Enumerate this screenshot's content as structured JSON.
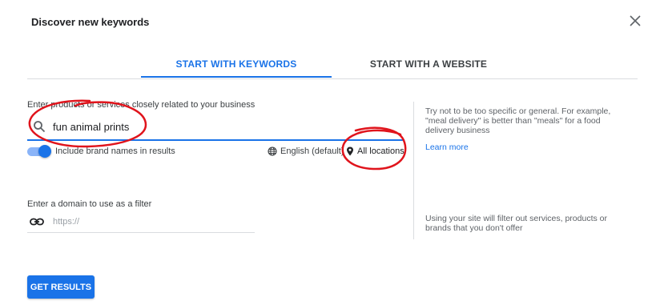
{
  "dialog": {
    "title": "Discover new keywords"
  },
  "tabs": [
    {
      "label": "START WITH KEYWORDS",
      "active": true
    },
    {
      "label": "START WITH A WEBSITE",
      "active": false
    }
  ],
  "keywords_section": {
    "label": "Enter products or services closely related to your business",
    "input_value": "fun animal prints",
    "brand_toggle": {
      "label": "Include brand names in results",
      "on": true
    },
    "language": "English (default)",
    "location": "All locations"
  },
  "hints": {
    "keywords_hint": "Try not to be too specific or general. For example, \"meal delivery\" is better than \"meals\" for a food delivery business",
    "learn_more": "Learn more",
    "domain_hint": "Using your site will filter out services, products or brands that you don't offer"
  },
  "domain_section": {
    "label": "Enter a domain to use as a filter",
    "placeholder": "https://",
    "value": ""
  },
  "actions": {
    "get_results": "GET RESULTS"
  },
  "colors": {
    "accent": "#1a73e8",
    "annotation": "#e0141c",
    "text": "#202124",
    "muted": "#5f6368"
  },
  "icons": [
    "close-icon",
    "search-icon",
    "globe-icon",
    "location-pin-icon",
    "link-icon"
  ]
}
